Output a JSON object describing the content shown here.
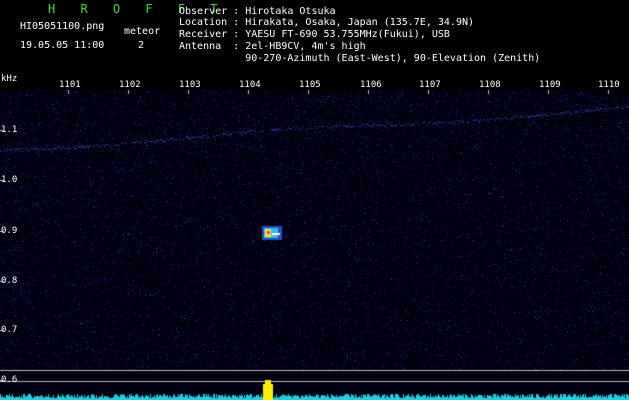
{
  "header": {
    "app_title": "H R O F F T",
    "filename": "HI05051100.png",
    "datetime": "19.05.05 11:00",
    "meteor_label": "meteor",
    "meteor_count": "2",
    "observer": "Observer : Hirotaka Otsuka",
    "location": "Location : Hirakata, Osaka, Japan (135.7E, 34.9N)",
    "receiver": "Receiver : YAESU FT-690 53.755MHz(Fukui), USB",
    "antenna": "Antenna  : 2el-HB9CV, 4m's high",
    "antenna2": "           90-270-Azimuth (East-West), 90-Elevation (Zenith)"
  },
  "axes": {
    "y_unit": "kHz",
    "y_ticks": [
      "1.1",
      "1.0",
      "0.9",
      "0.8",
      "0.7",
      "0.6"
    ],
    "x_ticks": [
      "1101",
      "1102",
      "1103",
      "1104",
      "1105",
      "1106",
      "1107",
      "1108",
      "1109",
      "1110"
    ]
  },
  "colors": {
    "background": "#000010",
    "noise": "#1a2a8a",
    "trace": "#3040b0",
    "meteor": "#ffe040",
    "level": "#20d0e0",
    "level_peak": "#ffee00",
    "grid": "#bbbbbb"
  }
}
